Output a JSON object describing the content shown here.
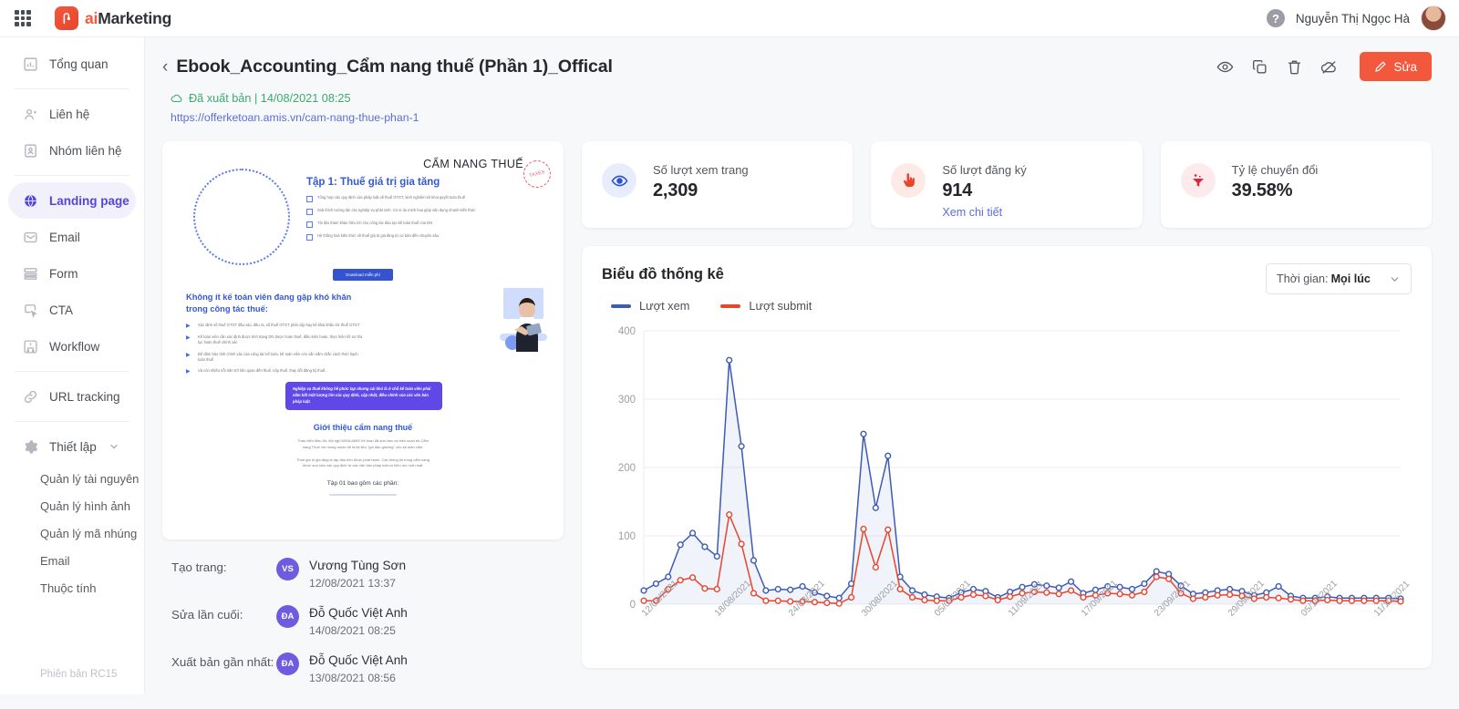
{
  "topbar": {
    "apps_icon": "grid-apps-icon",
    "brand_ai": "ai",
    "brand_marketing": "Marketing",
    "help_icon": "help-circle-icon",
    "user_name": "Nguyễn Thị Ngọc Hà",
    "avatar_icon": "user-avatar"
  },
  "sidebar": {
    "items": [
      {
        "label": "Tổng quan",
        "icon": "chart-bar-icon",
        "active": false
      },
      {
        "label": "Liên hệ",
        "icon": "user-icon",
        "active": false
      },
      {
        "label": "Nhóm liên hệ",
        "icon": "contact-card-icon",
        "active": false
      },
      {
        "label": "Landing page",
        "icon": "globe-icon",
        "active": true
      },
      {
        "label": "Email",
        "icon": "envelope-icon",
        "active": false
      },
      {
        "label": "Form",
        "icon": "form-icon",
        "active": false
      },
      {
        "label": "CTA",
        "icon": "cta-icon",
        "active": false
      },
      {
        "label": "Workflow",
        "icon": "workflow-icon",
        "active": false
      },
      {
        "label": "URL tracking",
        "icon": "link-icon",
        "active": false
      }
    ],
    "settings": {
      "label": "Thiết lập",
      "icon": "gear-icon",
      "chevron": "chevron-down-icon"
    },
    "sub_items": [
      "Quản lý tài nguyên",
      "Quản lý hình ảnh",
      "Quản lý mã nhúng",
      "Email",
      "Thuộc tính"
    ],
    "version": "Phiên bản RC15"
  },
  "header": {
    "back_icon": "chevron-left-icon",
    "title": "Ebook_Accounting_Cẩm nang thuế (Phần 1)_Offical",
    "status_icon": "cloud-published-icon",
    "status_text": "Đã xuất bản | 14/08/2021 08:25",
    "url": "https://offerketoan.amis.vn/cam-nang-thue-phan-1",
    "actions": [
      {
        "name": "preview-icon",
        "title": "Xem trước"
      },
      {
        "name": "copy-icon",
        "title": "Nhân bản"
      },
      {
        "name": "trash-icon",
        "title": "Xoá"
      },
      {
        "name": "unpublish-cloud-icon",
        "title": "Gỡ xuất bản"
      }
    ],
    "edit_button": {
      "label": "Sửa",
      "icon": "pencil-icon",
      "color": "#f2583c"
    }
  },
  "preview": {
    "hero_title": "CẨM NANG THUẾ",
    "stamp_text": "TAXES",
    "hero_sub": "Tập 1: Thuế giá trị gia tăng",
    "bullets": [
      "Tổng hợp các quy định của pháp luật về thuế GTGT, kinh nghiệm kê khai quyết toán thuế",
      "Giải thích tường tận các nghiệp vụ phát sinh. Có ví dụ minh hoạ giúp vận dụng nhanh kiến thức",
      "Tài liệu tham khảo hữu ích cho công tác đào tạo kế toán thuế của DN",
      "Hệ thống hoá kiến thức về thuế giá trị gia tăng từ cơ bản đến chuyên sâu."
    ],
    "cta_label": "Download miễn phí",
    "section2_title": "Không ít kế toán viên đang gặp khó khăn trong công tác thuế:",
    "section2_points": [
      "Xác định số thuế GTGT đầu vào, đầu ra, số thuế GTGT phải nộp hay kê khai khấu trừ thuế GTGT",
      "Kế toán viên cần xác định được tình trạng DN được hoàn thuế, điều kiện hoàn, thực hiện hồ sơ thủ tục hoàn thuế chính xác",
      "Để đảm bảo tính chính xác của công tác kế toán, kế toán viên còn cần nắm chắc cách thức hạch toán thuế",
      "Và còn nhiều nỗi trăn trở liên quan đến thuế, nộp thuế, thay đổi đăng ký thuế..."
    ],
    "quote": "Nghiệp vụ thuế không hề phức tạp nhưng cái khó là ở chỗ kế toán viên phải nắm bắt một lượng lớn các quy định, cập nhật, điều chỉnh của các văn bản pháp luật.",
    "section3_title": "Giới thiệu cẩm nang thuế",
    "section3_paras": [
      "Thấu hiểu điều đó, đội ngũ MISA AMIS Kế toán đã sưu tầm và biên soạn bộ Cẩm nang Thuế với mong muốn sẽ là tài liệu \"gối đầu giường\" cho kế toán viên.",
      "Thuế giá trị gia tăng là tập đầu tiên được phát hành. Các thông tin trong cẩm nang được sưu tầm các quy định từ các văn bản pháp luật có hiệu lực mới nhất."
    ],
    "footer_note": "Tập 01 bao gồm các phần:"
  },
  "meta": {
    "rows": [
      {
        "label": "Tạo trang:",
        "initials": "VS",
        "name": "Vương Tùng Sơn",
        "time": "12/08/2021 13:37"
      },
      {
        "label": "Sửa lần cuối:",
        "initials": "ĐA",
        "name": "Đỗ Quốc Việt Anh",
        "time": "14/08/2021 08:25"
      },
      {
        "label": "Xuất bản gần nhất:",
        "initials": "ĐA",
        "name": "Đỗ Quốc Việt Anh",
        "time": "13/08/2021 08:56"
      }
    ]
  },
  "stats": [
    {
      "label": "Số lượt xem trang",
      "value": "2,309",
      "icon": "eye-icon",
      "icon_color": "#2b53d4",
      "icon_bg": "#e8edfb",
      "link": null
    },
    {
      "label": "Số lượt đăng ký",
      "value": "914",
      "icon": "hand-click-icon",
      "icon_color": "#e8452c",
      "icon_bg": "#fdeae6",
      "link": "Xem chi tiết"
    },
    {
      "label": "Tỷ lệ chuyển đổi",
      "value": "39.58%",
      "icon": "funnel-icon",
      "icon_color": "#d9263c",
      "icon_bg": "#fdeaed",
      "link": null
    }
  ],
  "chart_panel": {
    "title": "Biểu đồ thống kê",
    "time_filter_label": "Thời gian:",
    "time_filter_value": "Mọi lúc",
    "chevron": "chevron-down-icon"
  },
  "chart_data": {
    "type": "line",
    "title": "Biểu đồ thống kê",
    "xlabel": "",
    "ylabel": "",
    "ylim": [
      0,
      400
    ],
    "yticks": [
      0,
      100,
      200,
      300,
      400
    ],
    "grid": true,
    "legend_position": "top-left",
    "colors": {
      "Lượt xem": "#3b5bb5",
      "Lượt submit": "#e8452c"
    },
    "x_tick_labels": [
      "12/08/2021",
      "18/08/2021",
      "24/08/2021",
      "30/08/2021",
      "05/09/2021",
      "11/09/2021",
      "17/09/2021",
      "23/09/2021",
      "29/09/2021",
      "05/10/2021",
      "11/10/2021"
    ],
    "x_tick_indices": [
      0,
      6,
      12,
      18,
      24,
      30,
      36,
      42,
      48,
      54,
      60
    ],
    "x": [
      "12/08/2021",
      "13/08/2021",
      "14/08/2021",
      "15/08/2021",
      "16/08/2021",
      "17/08/2021",
      "18/08/2021",
      "19/08/2021",
      "20/08/2021",
      "21/08/2021",
      "22/08/2021",
      "23/08/2021",
      "24/08/2021",
      "25/08/2021",
      "26/08/2021",
      "27/08/2021",
      "28/08/2021",
      "29/08/2021",
      "30/08/2021",
      "31/08/2021",
      "01/09/2021",
      "02/09/2021",
      "03/09/2021",
      "04/09/2021",
      "05/09/2021",
      "06/09/2021",
      "07/09/2021",
      "08/09/2021",
      "09/09/2021",
      "10/09/2021",
      "11/09/2021",
      "12/09/2021",
      "13/09/2021",
      "14/09/2021",
      "15/09/2021",
      "16/09/2021",
      "17/09/2021",
      "18/09/2021",
      "19/09/2021",
      "20/09/2021",
      "21/09/2021",
      "22/09/2021",
      "23/09/2021",
      "24/09/2021",
      "25/09/2021",
      "26/09/2021",
      "27/09/2021",
      "28/09/2021",
      "29/09/2021",
      "30/09/2021",
      "01/10/2021",
      "02/10/2021",
      "03/10/2021",
      "04/10/2021",
      "05/10/2021",
      "06/10/2021",
      "07/10/2021",
      "08/10/2021",
      "09/10/2021",
      "10/10/2021",
      "11/10/2021",
      "12/10/2021",
      "13/10/2021"
    ],
    "series": [
      {
        "name": "Lượt xem",
        "values": [
          20,
          30,
          40,
          87,
          104,
          84,
          70,
          357,
          231,
          64,
          20,
          22,
          21,
          26,
          17,
          12,
          9,
          30,
          249,
          141,
          217,
          40,
          20,
          14,
          11,
          9,
          17,
          22,
          19,
          10,
          18,
          25,
          29,
          27,
          24,
          33,
          16,
          21,
          26,
          25,
          22,
          30,
          48,
          44,
          27,
          15,
          17,
          20,
          22,
          19,
          13,
          17,
          26,
          12,
          9,
          9,
          11,
          9,
          9,
          9,
          9,
          9,
          8
        ]
      },
      {
        "name": "Lượt submit",
        "values": [
          5,
          5,
          22,
          35,
          39,
          23,
          22,
          131,
          88,
          16,
          5,
          5,
          4,
          4,
          3,
          2,
          1,
          10,
          110,
          54,
          109,
          22,
          10,
          6,
          5,
          5,
          10,
          14,
          12,
          6,
          11,
          16,
          18,
          17,
          15,
          20,
          10,
          13,
          16,
          15,
          13,
          18,
          40,
          37,
          16,
          8,
          10,
          13,
          14,
          12,
          8,
          10,
          9,
          7,
          5,
          5,
          6,
          5,
          5,
          5,
          5,
          5,
          4
        ]
      }
    ]
  }
}
